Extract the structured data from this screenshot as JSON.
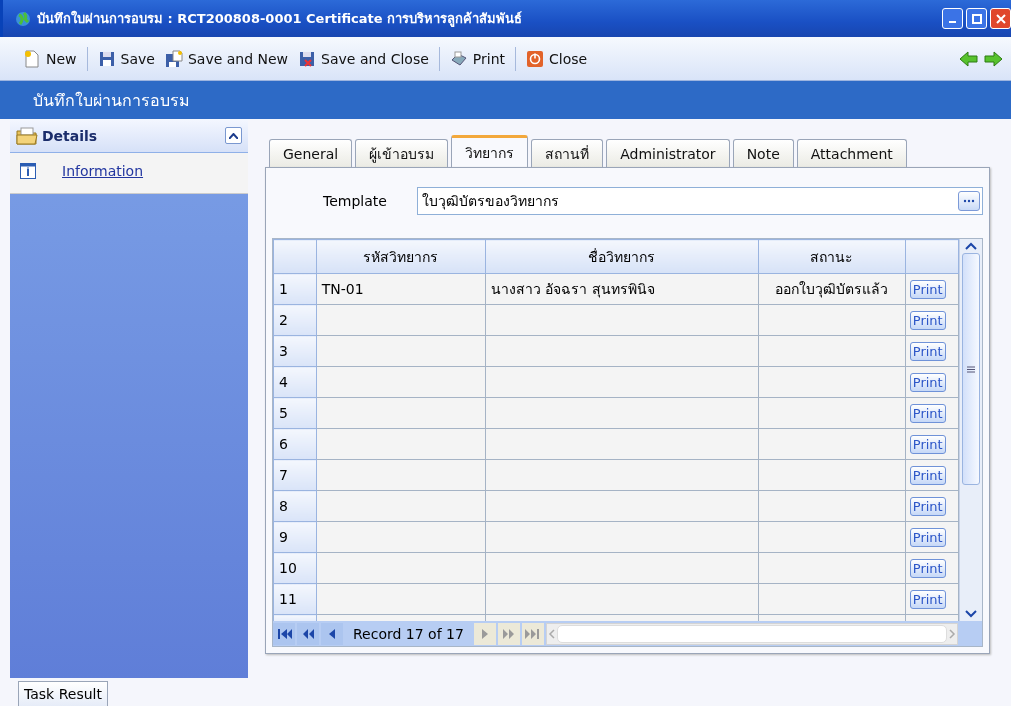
{
  "window": {
    "title": "บันทึกใบผ่านการอบรม : RCT200808-0001 Certificate การบริหารลูกค้าสัมพันธ์"
  },
  "toolbar": [
    {
      "kind": "new",
      "label": "New"
    },
    {
      "kind": "save",
      "label": "Save"
    },
    {
      "kind": "save_new",
      "label": "Save and New"
    },
    {
      "kind": "save_close",
      "label": "Save and Close"
    },
    {
      "kind": "print",
      "label": "Print"
    },
    {
      "kind": "close",
      "label": "Close"
    }
  ],
  "header": {
    "title": "บันทึกใบผ่านการอบรม"
  },
  "sidebar": {
    "title": "Details",
    "expanded": true,
    "items": [
      {
        "label": "Information"
      }
    ]
  },
  "tabs": [
    {
      "label": "General",
      "selected": false
    },
    {
      "label": "ผู้เข้าอบรม",
      "selected": false
    },
    {
      "label": "วิทยากร",
      "selected": true
    },
    {
      "label": "สถานที่",
      "selected": false
    },
    {
      "label": "Administrator",
      "selected": false
    },
    {
      "label": "Note",
      "selected": false
    },
    {
      "label": "Attachment",
      "selected": false
    }
  ],
  "template": {
    "label": "Template",
    "value": "ใบวุฒิบัตรของวิทยากร"
  },
  "grid": {
    "columns": [
      "รหัสวิทยากร",
      "ชื่อวิทยากร",
      "สถานะ"
    ],
    "rows": [
      {
        "num": "1",
        "code": "TN-01",
        "name": "นางสาว อัจฉรา สุนทรพินิจ",
        "status": "ออกใบวุฒิบัตรแล้ว",
        "action": "Print"
      },
      {
        "num": "2",
        "action": "Print"
      },
      {
        "num": "3",
        "action": "Print"
      },
      {
        "num": "4",
        "action": "Print"
      },
      {
        "num": "5",
        "action": "Print"
      },
      {
        "num": "6",
        "action": "Print"
      },
      {
        "num": "7",
        "action": "Print"
      },
      {
        "num": "8",
        "action": "Print"
      },
      {
        "num": "9",
        "action": "Print"
      },
      {
        "num": "10",
        "action": "Print"
      },
      {
        "num": "11",
        "action": "Print"
      }
    ]
  },
  "pager": {
    "record": "Record 17 of 17",
    "buttons": [
      {
        "kind": "first",
        "disabled": false
      },
      {
        "kind": "prev_page",
        "disabled": false
      },
      {
        "kind": "prev",
        "disabled": false
      },
      {
        "kind": "next",
        "disabled": true
      },
      {
        "kind": "next_page",
        "disabled": true
      },
      {
        "kind": "last",
        "disabled": true
      }
    ]
  },
  "bottom_tab": {
    "label": "Task Result"
  }
}
